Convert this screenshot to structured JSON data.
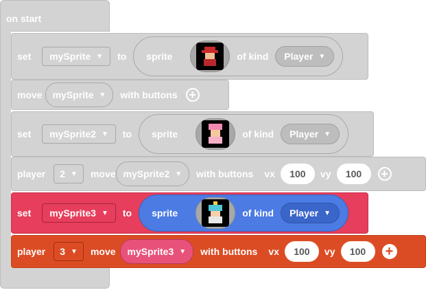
{
  "hat": {
    "label": "on start"
  },
  "rows": {
    "r1": {
      "set": "set",
      "var": "mySprite",
      "to": "to",
      "sprite": "sprite",
      "of_kind": "of kind",
      "kind": "Player"
    },
    "r2": {
      "move": "move",
      "var": "mySprite",
      "with_buttons": "with buttons"
    },
    "r3": {
      "set": "set",
      "var": "mySprite2",
      "to": "to",
      "sprite": "sprite",
      "of_kind": "of kind",
      "kind": "Player"
    },
    "r4": {
      "player": "player",
      "num": "2",
      "move": "move",
      "var": "mySprite2",
      "with_buttons": "with buttons",
      "vx": "vx",
      "vx_val": "100",
      "vy": "vy",
      "vy_val": "100"
    },
    "r5": {
      "set": "set",
      "var": "mySprite3",
      "to": "to",
      "sprite": "sprite",
      "of_kind": "of kind",
      "kind": "Player"
    },
    "r6": {
      "player": "player",
      "num": "3",
      "move": "move",
      "var": "mySprite3",
      "with_buttons": "with buttons",
      "vx": "vx",
      "vx_val": "100",
      "vy": "vy",
      "vy_val": "100"
    }
  },
  "icons": {
    "plus": "plus-icon",
    "caret": "caret-down-icon",
    "caret_glyph": "▼",
    "plus_glyph": "+"
  },
  "colors": {
    "gray_block": "#d3d3d3",
    "set_red": "#e63e5c",
    "controller_orange": "#dc4c24",
    "sprite_blue": "#4b7be3"
  }
}
